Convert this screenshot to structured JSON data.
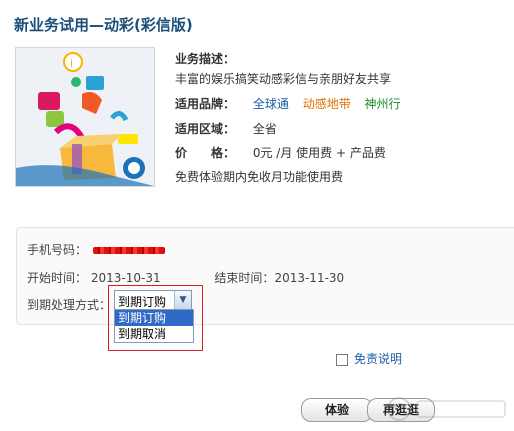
{
  "title": "新业务试用—动彩(彩信版)",
  "info": {
    "desc_label": "业务描述：",
    "desc_text": "丰富的娱乐搞笑动感彩信与亲朋好友共享",
    "brand_label": "适用品牌：",
    "brands": [
      {
        "name": "全球通",
        "color": "#1a5fa8"
      },
      {
        "name": "动感地带",
        "color": "#e07000"
      },
      {
        "name": "神州行",
        "color": "#1f8a2a"
      }
    ],
    "region_label": "适用区域：",
    "region_value": "全省",
    "price_label_a": "价",
    "price_label_b": "格：",
    "price_value": "0元 /月 使用费 + 产品费",
    "note": "免费体验期内免收月功能使用费"
  },
  "panel": {
    "phone_label": "手机号码：",
    "start_label": "开始时间：",
    "start_value": "2013-10-31",
    "end_label": "结束时间：",
    "end_value": "2013-11-30",
    "expiry_label": "到期处理方式：",
    "expiry_selected": "到期订购",
    "expiry_options": [
      "到期订购",
      "到期取消"
    ]
  },
  "disclaimer_label": "免责说明",
  "buttons": {
    "trial": "体验",
    "browse": "再逛逛"
  },
  "colors": {
    "title": "#1a4f7a",
    "highlight_box": "#d61f1f",
    "selected_option": "#3169c6"
  }
}
